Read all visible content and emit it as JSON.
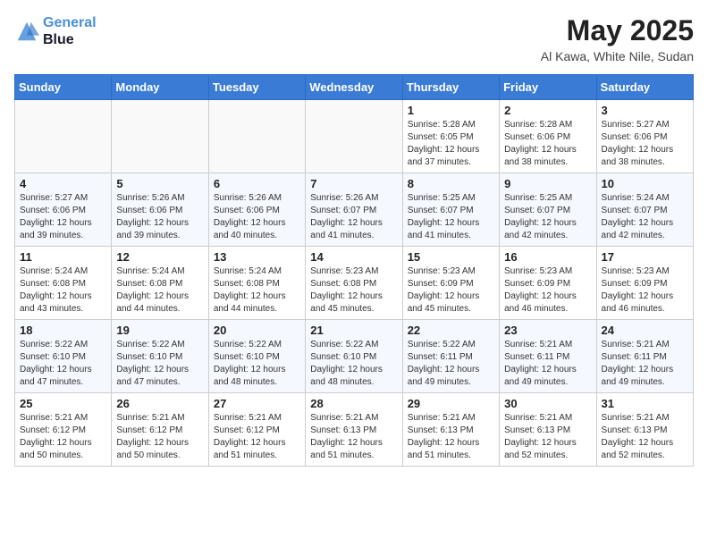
{
  "header": {
    "logo_line1": "General",
    "logo_line2": "Blue",
    "month": "May 2025",
    "location": "Al Kawa, White Nile, Sudan"
  },
  "weekdays": [
    "Sunday",
    "Monday",
    "Tuesday",
    "Wednesday",
    "Thursday",
    "Friday",
    "Saturday"
  ],
  "weeks": [
    [
      {
        "day": "",
        "info": ""
      },
      {
        "day": "",
        "info": ""
      },
      {
        "day": "",
        "info": ""
      },
      {
        "day": "",
        "info": ""
      },
      {
        "day": "1",
        "info": "Sunrise: 5:28 AM\nSunset: 6:05 PM\nDaylight: 12 hours\nand 37 minutes."
      },
      {
        "day": "2",
        "info": "Sunrise: 5:28 AM\nSunset: 6:06 PM\nDaylight: 12 hours\nand 38 minutes."
      },
      {
        "day": "3",
        "info": "Sunrise: 5:27 AM\nSunset: 6:06 PM\nDaylight: 12 hours\nand 38 minutes."
      }
    ],
    [
      {
        "day": "4",
        "info": "Sunrise: 5:27 AM\nSunset: 6:06 PM\nDaylight: 12 hours\nand 39 minutes."
      },
      {
        "day": "5",
        "info": "Sunrise: 5:26 AM\nSunset: 6:06 PM\nDaylight: 12 hours\nand 39 minutes."
      },
      {
        "day": "6",
        "info": "Sunrise: 5:26 AM\nSunset: 6:06 PM\nDaylight: 12 hours\nand 40 minutes."
      },
      {
        "day": "7",
        "info": "Sunrise: 5:26 AM\nSunset: 6:07 PM\nDaylight: 12 hours\nand 41 minutes."
      },
      {
        "day": "8",
        "info": "Sunrise: 5:25 AM\nSunset: 6:07 PM\nDaylight: 12 hours\nand 41 minutes."
      },
      {
        "day": "9",
        "info": "Sunrise: 5:25 AM\nSunset: 6:07 PM\nDaylight: 12 hours\nand 42 minutes."
      },
      {
        "day": "10",
        "info": "Sunrise: 5:24 AM\nSunset: 6:07 PM\nDaylight: 12 hours\nand 42 minutes."
      }
    ],
    [
      {
        "day": "11",
        "info": "Sunrise: 5:24 AM\nSunset: 6:08 PM\nDaylight: 12 hours\nand 43 minutes."
      },
      {
        "day": "12",
        "info": "Sunrise: 5:24 AM\nSunset: 6:08 PM\nDaylight: 12 hours\nand 44 minutes."
      },
      {
        "day": "13",
        "info": "Sunrise: 5:24 AM\nSunset: 6:08 PM\nDaylight: 12 hours\nand 44 minutes."
      },
      {
        "day": "14",
        "info": "Sunrise: 5:23 AM\nSunset: 6:08 PM\nDaylight: 12 hours\nand 45 minutes."
      },
      {
        "day": "15",
        "info": "Sunrise: 5:23 AM\nSunset: 6:09 PM\nDaylight: 12 hours\nand 45 minutes."
      },
      {
        "day": "16",
        "info": "Sunrise: 5:23 AM\nSunset: 6:09 PM\nDaylight: 12 hours\nand 46 minutes."
      },
      {
        "day": "17",
        "info": "Sunrise: 5:23 AM\nSunset: 6:09 PM\nDaylight: 12 hours\nand 46 minutes."
      }
    ],
    [
      {
        "day": "18",
        "info": "Sunrise: 5:22 AM\nSunset: 6:10 PM\nDaylight: 12 hours\nand 47 minutes."
      },
      {
        "day": "19",
        "info": "Sunrise: 5:22 AM\nSunset: 6:10 PM\nDaylight: 12 hours\nand 47 minutes."
      },
      {
        "day": "20",
        "info": "Sunrise: 5:22 AM\nSunset: 6:10 PM\nDaylight: 12 hours\nand 48 minutes."
      },
      {
        "day": "21",
        "info": "Sunrise: 5:22 AM\nSunset: 6:10 PM\nDaylight: 12 hours\nand 48 minutes."
      },
      {
        "day": "22",
        "info": "Sunrise: 5:22 AM\nSunset: 6:11 PM\nDaylight: 12 hours\nand 49 minutes."
      },
      {
        "day": "23",
        "info": "Sunrise: 5:21 AM\nSunset: 6:11 PM\nDaylight: 12 hours\nand 49 minutes."
      },
      {
        "day": "24",
        "info": "Sunrise: 5:21 AM\nSunset: 6:11 PM\nDaylight: 12 hours\nand 49 minutes."
      }
    ],
    [
      {
        "day": "25",
        "info": "Sunrise: 5:21 AM\nSunset: 6:12 PM\nDaylight: 12 hours\nand 50 minutes."
      },
      {
        "day": "26",
        "info": "Sunrise: 5:21 AM\nSunset: 6:12 PM\nDaylight: 12 hours\nand 50 minutes."
      },
      {
        "day": "27",
        "info": "Sunrise: 5:21 AM\nSunset: 6:12 PM\nDaylight: 12 hours\nand 51 minutes."
      },
      {
        "day": "28",
        "info": "Sunrise: 5:21 AM\nSunset: 6:13 PM\nDaylight: 12 hours\nand 51 minutes."
      },
      {
        "day": "29",
        "info": "Sunrise: 5:21 AM\nSunset: 6:13 PM\nDaylight: 12 hours\nand 51 minutes."
      },
      {
        "day": "30",
        "info": "Sunrise: 5:21 AM\nSunset: 6:13 PM\nDaylight: 12 hours\nand 52 minutes."
      },
      {
        "day": "31",
        "info": "Sunrise: 5:21 AM\nSunset: 6:13 PM\nDaylight: 12 hours\nand 52 minutes."
      }
    ]
  ]
}
